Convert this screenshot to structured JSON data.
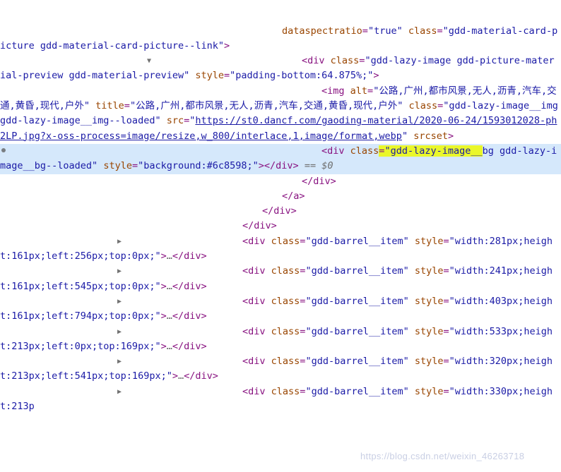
{
  "panel": {
    "name": "devtools-elements-dom-tree",
    "selected_marker": "==$0",
    "highlight_color": "#eaf72a",
    "selection_color": "#d5e8fb"
  },
  "watermark": "https://blog.csdn.net/weixin_46263718",
  "lines": [
    {
      "id": "l0",
      "arrow": "none",
      "indent": 2,
      "clipped": true,
      "segments": [
        {
          "t": "attr-name",
          "v": "dataspectratio"
        },
        {
          "t": "punct",
          "v": "="
        },
        {
          "t": "attr-value",
          "v": "\"true\""
        },
        {
          "t": "text",
          "v": " "
        },
        {
          "t": "attr-name",
          "v": "class"
        },
        {
          "t": "punct",
          "v": "="
        },
        {
          "t": "attr-value",
          "v": "\"gdd-material-card-picture gdd-material-card-picture--link\""
        },
        {
          "t": "tag",
          "v": ">"
        }
      ]
    },
    {
      "id": "l1",
      "arrow": "open",
      "indent": 3,
      "clipped": false,
      "segments": [
        {
          "t": "tag",
          "v": "<div"
        },
        {
          "t": "text",
          "v": " "
        },
        {
          "t": "attr-name",
          "v": "class"
        },
        {
          "t": "punct",
          "v": "="
        },
        {
          "t": "attr-value",
          "v": "\"gdd-lazy-image gdd-picture-material-preview gdd-material-preview\""
        },
        {
          "t": "text",
          "v": " "
        },
        {
          "t": "attr-name",
          "v": "style"
        },
        {
          "t": "punct",
          "v": "="
        },
        {
          "t": "attr-value",
          "v": "\"padding-bottom:64.875%;\""
        },
        {
          "t": "tag",
          "v": ">"
        }
      ]
    },
    {
      "id": "l2",
      "arrow": "none",
      "indent": 4,
      "clipped": false,
      "segments": [
        {
          "t": "tag",
          "v": "<img"
        },
        {
          "t": "text",
          "v": " "
        },
        {
          "t": "attr-name",
          "v": "alt"
        },
        {
          "t": "punct",
          "v": "="
        },
        {
          "t": "attr-value",
          "v": "\"公路,广州,都市风景,无人,沥青,汽车,交通,黄昏,现代,户外\""
        },
        {
          "t": "text",
          "v": " "
        },
        {
          "t": "attr-name",
          "v": "title"
        },
        {
          "t": "punct",
          "v": "="
        },
        {
          "t": "attr-value",
          "v": "\"公路,广州,都市风景,无人,沥青,汽车,交通,黄昏,现代,户外\""
        },
        {
          "t": "text",
          "v": " "
        },
        {
          "t": "attr-name",
          "v": "class"
        },
        {
          "t": "punct",
          "v": "="
        },
        {
          "t": "attr-value",
          "v": "\"gdd-lazy-image__img gdd-lazy-image__img--loaded\""
        },
        {
          "t": "text",
          "v": " "
        },
        {
          "t": "attr-name",
          "v": "src"
        },
        {
          "t": "punct",
          "v": "="
        },
        {
          "t": "attr-value",
          "v": "\""
        },
        {
          "t": "link",
          "v": "https://st0.dancf.com/gaoding-material/2020-06-24/1593012028-ph2LP.jpg?x-oss-process=image/resize,w_800/interlace,1,image/format,webp"
        },
        {
          "t": "attr-value",
          "v": "\""
        },
        {
          "t": "text",
          "v": " "
        },
        {
          "t": "attr-name",
          "v": "srcset"
        },
        {
          "t": "tag",
          "v": ">"
        }
      ]
    },
    {
      "id": "l3",
      "arrow": "none",
      "indent": 4,
      "selected": true,
      "clipped": false,
      "segments": [
        {
          "t": "tag",
          "v": "<div"
        },
        {
          "t": "text",
          "v": " "
        },
        {
          "t": "attr-name",
          "v": "class"
        },
        {
          "t": "punct",
          "v": "=",
          "hl": true
        },
        {
          "t": "attr-value",
          "v": "\"gdd-lazy-image__",
          "hl": true
        },
        {
          "t": "attr-value",
          "v": "bg gdd-lazy-image__bg--loaded\""
        },
        {
          "t": "text",
          "v": " "
        },
        {
          "t": "attr-name",
          "v": "style"
        },
        {
          "t": "punct",
          "v": "="
        },
        {
          "t": "attr-value",
          "v": "\"background:#6c8598;\""
        },
        {
          "t": "tag",
          "v": ">"
        },
        {
          "t": "tag",
          "v": "</div>"
        },
        {
          "t": "dollar",
          "v": " == $0"
        }
      ]
    },
    {
      "id": "l4",
      "arrow": "none",
      "indent": 3,
      "clipped": false,
      "segments": [
        {
          "t": "tag",
          "v": "</div>"
        }
      ]
    },
    {
      "id": "l5",
      "arrow": "none",
      "indent": 2,
      "clipped": false,
      "segments": [
        {
          "t": "tag",
          "v": "</a>"
        }
      ]
    },
    {
      "id": "l6",
      "arrow": "none",
      "indent": 1,
      "clipped": false,
      "segments": [
        {
          "t": "tag",
          "v": "</div>"
        }
      ]
    },
    {
      "id": "l7",
      "arrow": "none",
      "indent": 0,
      "clipped": false,
      "segments": [
        {
          "t": "tag",
          "v": "</div>"
        }
      ]
    },
    {
      "id": "l8",
      "arrow": "closed",
      "indent": 0,
      "clipped": false,
      "segments": [
        {
          "t": "tag",
          "v": "<div"
        },
        {
          "t": "text",
          "v": " "
        },
        {
          "t": "attr-name",
          "v": "class"
        },
        {
          "t": "punct",
          "v": "="
        },
        {
          "t": "attr-value",
          "v": "\"gdd-barrel__item\""
        },
        {
          "t": "text",
          "v": " "
        },
        {
          "t": "attr-name",
          "v": "style"
        },
        {
          "t": "punct",
          "v": "="
        },
        {
          "t": "attr-value",
          "v": "\"width:281px;height:161px;left:256px;top:0px;\""
        },
        {
          "t": "tag",
          "v": ">"
        },
        {
          "t": "ellipsis",
          "v": "…"
        },
        {
          "t": "tag",
          "v": "</div>"
        }
      ]
    },
    {
      "id": "l9",
      "arrow": "closed",
      "indent": 0,
      "clipped": false,
      "segments": [
        {
          "t": "tag",
          "v": "<div"
        },
        {
          "t": "text",
          "v": " "
        },
        {
          "t": "attr-name",
          "v": "class"
        },
        {
          "t": "punct",
          "v": "="
        },
        {
          "t": "attr-value",
          "v": "\"gdd-barrel__item\""
        },
        {
          "t": "text",
          "v": " "
        },
        {
          "t": "attr-name",
          "v": "style"
        },
        {
          "t": "punct",
          "v": "="
        },
        {
          "t": "attr-value",
          "v": "\"width:241px;height:161px;left:545px;top:0px;\""
        },
        {
          "t": "tag",
          "v": ">"
        },
        {
          "t": "ellipsis",
          "v": "…"
        },
        {
          "t": "tag",
          "v": "</div>"
        }
      ]
    },
    {
      "id": "l10",
      "arrow": "closed",
      "indent": 0,
      "clipped": false,
      "segments": [
        {
          "t": "tag",
          "v": "<div"
        },
        {
          "t": "text",
          "v": " "
        },
        {
          "t": "attr-name",
          "v": "class"
        },
        {
          "t": "punct",
          "v": "="
        },
        {
          "t": "attr-value",
          "v": "\"gdd-barrel__item\""
        },
        {
          "t": "text",
          "v": " "
        },
        {
          "t": "attr-name",
          "v": "style"
        },
        {
          "t": "punct",
          "v": "="
        },
        {
          "t": "attr-value",
          "v": "\"width:403px;height:161px;left:794px;top:0px;\""
        },
        {
          "t": "tag",
          "v": ">"
        },
        {
          "t": "ellipsis",
          "v": "…"
        },
        {
          "t": "tag",
          "v": "</div>"
        }
      ]
    },
    {
      "id": "l11",
      "arrow": "closed",
      "indent": 0,
      "clipped": false,
      "segments": [
        {
          "t": "tag",
          "v": "<div"
        },
        {
          "t": "text",
          "v": " "
        },
        {
          "t": "attr-name",
          "v": "class"
        },
        {
          "t": "punct",
          "v": "="
        },
        {
          "t": "attr-value",
          "v": "\"gdd-barrel__item\""
        },
        {
          "t": "text",
          "v": " "
        },
        {
          "t": "attr-name",
          "v": "style"
        },
        {
          "t": "punct",
          "v": "="
        },
        {
          "t": "attr-value",
          "v": "\"width:533px;height:213px;left:0px;top:169px;\""
        },
        {
          "t": "tag",
          "v": ">"
        },
        {
          "t": "ellipsis",
          "v": "…"
        },
        {
          "t": "tag",
          "v": "</div>"
        }
      ]
    },
    {
      "id": "l12",
      "arrow": "closed",
      "indent": 0,
      "clipped": false,
      "segments": [
        {
          "t": "tag",
          "v": "<div"
        },
        {
          "t": "text",
          "v": " "
        },
        {
          "t": "attr-name",
          "v": "class"
        },
        {
          "t": "punct",
          "v": "="
        },
        {
          "t": "attr-value",
          "v": "\"gdd-barrel__item\""
        },
        {
          "t": "text",
          "v": " "
        },
        {
          "t": "attr-name",
          "v": "style"
        },
        {
          "t": "punct",
          "v": "="
        },
        {
          "t": "attr-value",
          "v": "\"width:320px;height:213px;left:541px;top:169px;\""
        },
        {
          "t": "tag",
          "v": ">"
        },
        {
          "t": "ellipsis",
          "v": "…"
        },
        {
          "t": "tag",
          "v": "</div>"
        }
      ]
    },
    {
      "id": "l13",
      "arrow": "closed",
      "indent": 0,
      "clipped": true,
      "segments": [
        {
          "t": "tag",
          "v": "<div"
        },
        {
          "t": "text",
          "v": " "
        },
        {
          "t": "attr-name",
          "v": "class"
        },
        {
          "t": "punct",
          "v": "="
        },
        {
          "t": "attr-value",
          "v": "\"gdd-barrel__item\""
        },
        {
          "t": "text",
          "v": " "
        },
        {
          "t": "attr-name",
          "v": "style"
        },
        {
          "t": "punct",
          "v": "="
        },
        {
          "t": "attr-value",
          "v": "\"width:330px;height:213p"
        }
      ]
    }
  ]
}
